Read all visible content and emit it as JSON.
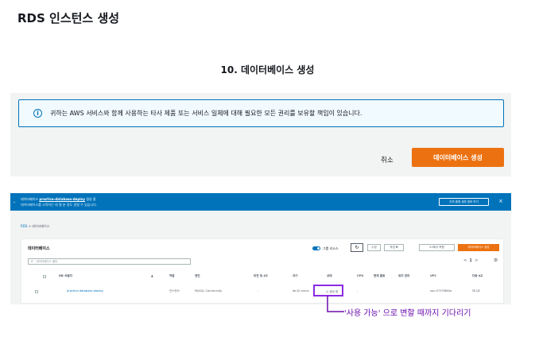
{
  "page_title": "RDS 인스턴스 생성",
  "step_title": "10. 데이터베이스 생성",
  "info_box": {
    "text": "귀하는 AWS 서비스와 함께 사용하는 타사 제품 또는 서비스 일체에 대해 필요한 모든 권리를 보유할 책임이 있습니다."
  },
  "actions": {
    "cancel": "취소",
    "create": "데이터베이스 생성"
  },
  "console": {
    "flash": {
      "line1_prefix": "데이터베이스",
      "db_name": "practice-database-deploy",
      "line1_suffix": "생성 중",
      "line2": "데이터베이스를 시작하는 데 몇 분 정도 걸릴 수 있습니다.",
      "details_button": "자격 증명 세부 정보 보기",
      "close": "×"
    },
    "breadcrumb": {
      "root": "RDS",
      "sep": ">",
      "current": "데이터베이스"
    },
    "card_title": "데이터베이스",
    "group_toggle_label": "그룹 리소스",
    "buttons": {
      "modify": "수정",
      "actions": "작업 ▼",
      "restore_s3": "S3에서 복원",
      "create": "데이터베이스 생성"
    },
    "filter_placeholder": "데이터베이스 필터",
    "pager": {
      "prev": "<",
      "page": "1",
      "next": ">"
    },
    "columns": [
      "DB 식별자",
      "역할",
      "엔진",
      "리전 및 AZ",
      "크기",
      "상태",
      "CPU",
      "현재 활동",
      "유지 관리",
      "VPC",
      "다중 AZ"
    ],
    "row": {
      "identifier": "practice-database-deploy",
      "role": "인스턴스",
      "engine": "MySQL Community",
      "region_az": "-",
      "size": "db.t2.micro",
      "status": "생성 중",
      "cpu": "-",
      "activity": "",
      "maintenance": "",
      "vpc": "vpc-0737f660a",
      "multi_az": "아니요"
    }
  },
  "annotation": "'사용 가능' 으로 변할 때까지 기다리기",
  "colors": {
    "aws_orange": "#ec7211",
    "aws_blue": "#0073bb",
    "highlight": "#8a2be2"
  }
}
